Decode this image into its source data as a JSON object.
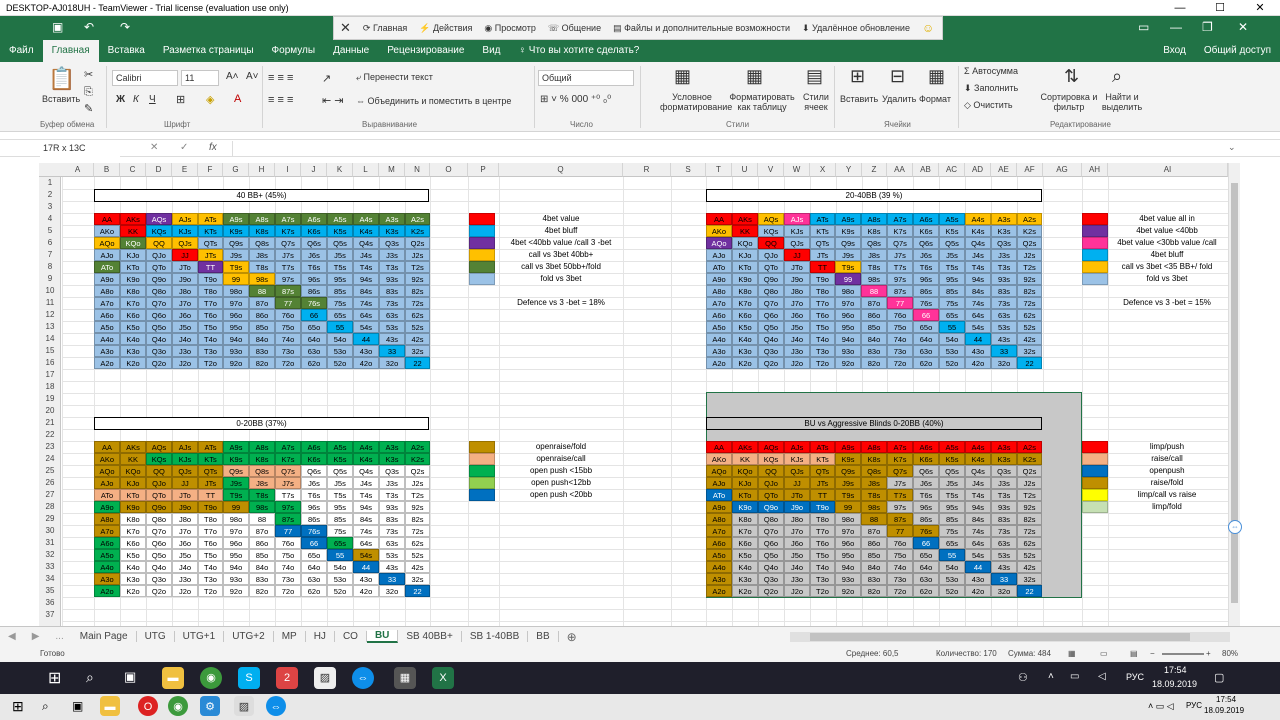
{
  "window": {
    "tv_title": "DESKTOP-AJ018UH - TeamViewer - Trial license (evaluation use only)",
    "min": "—",
    "max": "☐",
    "close": "✕"
  },
  "teamviewer": {
    "items": [
      "Главная",
      "Действия",
      "Просмотр",
      "Общение",
      "Файлы и дополнительные возможности",
      "Удалённое обновление"
    ],
    "icons": [
      "close-icon",
      "home-icon",
      "lightning-icon",
      "eye-icon",
      "chat-icon",
      "file-icon",
      "download-icon",
      "smile-icon"
    ]
  },
  "ribbon_tabs": [
    "Файл",
    "Главная",
    "Вставка",
    "Разметка страницы",
    "Формулы",
    "Данные",
    "Рецензирование",
    "Вид",
    "♀ Что вы хотите сделать?"
  ],
  "ribbon_right": {
    "login": "Вход",
    "share": "Общий доступ"
  },
  "ribbon": {
    "paste": "Вставить",
    "clipboard": "Буфер обмена",
    "font_name": "Calibri",
    "font_size": "11",
    "font_group": "Шрифт",
    "wrap": "Перенести текст",
    "merge": "Объединить и поместить в центре",
    "align_group": "Выравнивание",
    "num_format": "Общий",
    "num_group": "Число",
    "cond": "Условное форматирование",
    "table": "Форматировать как таблицу",
    "styles": "Стили ячеек",
    "styles_group": "Стили",
    "insert": "Вставить",
    "delete": "Удалить",
    "format": "Формат",
    "cells_group": "Ячейки",
    "autosum": "Автосумма",
    "fill": "Заполнить",
    "clear": "Очистить",
    "sort": "Сортировка и фильтр",
    "find": "Найти и выделить",
    "edit_group": "Редактирование",
    "bold": "Ж",
    "italic": "К",
    "underline": "Ч"
  },
  "formula": {
    "namebox": "17R x 13C",
    "fx": "fx",
    "value": ""
  },
  "columns": [
    "A",
    "B",
    "C",
    "D",
    "E",
    "F",
    "G",
    "H",
    "I",
    "J",
    "K",
    "L",
    "M",
    "N",
    "O",
    "P",
    "Q",
    "R",
    "S",
    "T",
    "U",
    "V",
    "W",
    "X",
    "Y",
    "Z",
    "AA",
    "AB",
    "AC",
    "AD",
    "AE",
    "AF",
    "AG",
    "AH",
    "AI"
  ],
  "rows": [
    "1",
    "2",
    "3",
    "4",
    "5",
    "6",
    "7",
    "8",
    "9",
    "10",
    "11",
    "12",
    "13",
    "14",
    "15",
    "16",
    "17",
    "18",
    "19",
    "20",
    "21",
    "22",
    "23",
    "24",
    "25",
    "26",
    "27",
    "28",
    "29",
    "30",
    "31",
    "32",
    "33",
    "34",
    "35",
    "36",
    "37"
  ],
  "titles": {
    "t1": "40 BB+ (45%)",
    "t2": "20-40BB (39 %)",
    "t3": "0-20BB (37%)",
    "t4": "BU vs Aggressive Blinds 0-20BB (40%)"
  },
  "grid": [
    [
      "AA",
      "AKs",
      "AQs",
      "AJs",
      "ATs",
      "A9s",
      "A8s",
      "A7s",
      "A6s",
      "A5s",
      "A4s",
      "A3s",
      "A2s"
    ],
    [
      "AKo",
      "KK",
      "KQs",
      "KJs",
      "KTs",
      "K9s",
      "K8s",
      "K7s",
      "K6s",
      "K5s",
      "K4s",
      "K3s",
      "K2s"
    ],
    [
      "AQo",
      "KQo",
      "QQ",
      "QJs",
      "QTs",
      "Q9s",
      "Q8s",
      "Q7s",
      "Q6s",
      "Q5s",
      "Q4s",
      "Q3s",
      "Q2s"
    ],
    [
      "AJo",
      "KJo",
      "QJo",
      "JJ",
      "JTs",
      "J9s",
      "J8s",
      "J7s",
      "J6s",
      "J5s",
      "J4s",
      "J3s",
      "J2s"
    ],
    [
      "ATo",
      "KTo",
      "QTo",
      "JTo",
      "TT",
      "T9s",
      "T8s",
      "T7s",
      "T6s",
      "T5s",
      "T4s",
      "T3s",
      "T2s"
    ],
    [
      "A9o",
      "K9o",
      "Q9o",
      "J9o",
      "T9o",
      "99",
      "98s",
      "97s",
      "96s",
      "95s",
      "94s",
      "93s",
      "92s"
    ],
    [
      "A8o",
      "K8o",
      "Q8o",
      "J8o",
      "T8o",
      "98o",
      "88",
      "87s",
      "86s",
      "85s",
      "84s",
      "83s",
      "82s"
    ],
    [
      "A7o",
      "K7o",
      "Q7o",
      "J7o",
      "T7o",
      "97o",
      "87o",
      "77",
      "76s",
      "75s",
      "74s",
      "73s",
      "72s"
    ],
    [
      "A6o",
      "K6o",
      "Q6o",
      "J6o",
      "T6o",
      "96o",
      "86o",
      "76o",
      "66",
      "65s",
      "64s",
      "63s",
      "62s"
    ],
    [
      "A5o",
      "K5o",
      "Q5o",
      "J5o",
      "T5o",
      "95o",
      "85o",
      "75o",
      "65o",
      "55",
      "54s",
      "53s",
      "52s"
    ],
    [
      "A4o",
      "K4o",
      "Q4o",
      "J4o",
      "T4o",
      "94o",
      "84o",
      "74o",
      "64o",
      "54o",
      "44",
      "43s",
      "42s"
    ],
    [
      "A3o",
      "K3o",
      "Q3o",
      "J3o",
      "T3o",
      "93o",
      "83o",
      "73o",
      "63o",
      "53o",
      "43o",
      "33",
      "32s"
    ],
    [
      "A2o",
      "K2o",
      "Q2o",
      "J2o",
      "T2o",
      "92o",
      "82o",
      "72o",
      "62o",
      "52o",
      "42o",
      "32o",
      "22"
    ]
  ],
  "legend1": {
    "items": [
      "4bet value",
      "4bet bluff",
      "4bet <40bb value /call 3 -bet",
      "call vs 3bet 40bb+",
      "call vs 3bet 50bb+/fold",
      "fold vs 3bet"
    ],
    "colors": [
      "#ff0000",
      "#00b0f0",
      "#7030a0",
      "#ffc000",
      "#548235",
      "#9bc2e6"
    ],
    "note": "Defence vs 3 -bet = 18%"
  },
  "legend2": {
    "items": [
      "4bet value all in",
      "4bet value <40bb",
      "4bet value <30bb value /call",
      "4bet bluff",
      "call vs 3bet <35 BB+/ fold",
      "fold vs 3bet"
    ],
    "colors": [
      "#ff0000",
      "#7030a0",
      "#ff3399",
      "#00b0f0",
      "#ffc000",
      "#9bc2e6"
    ],
    "note": "Defence vs 3 -bet = 15%"
  },
  "legend3": {
    "items": [
      "openraise/fold",
      "openraise/call",
      "open push <15bb",
      "open push<12bb",
      "open push <20bb"
    ],
    "colors": [
      "#bf8f00",
      "#f4b084",
      "#00b050",
      "#92d050",
      "#0070c0"
    ]
  },
  "legend4": {
    "items": [
      "limp/push",
      "raise/call",
      "openpush",
      "raise/fold",
      "limp/call vs raise",
      "limp/fold"
    ],
    "colors": [
      "#ff0000",
      "#f4b084",
      "#0070c0",
      "#bf8f00",
      "#ffff00",
      "#c6e0b4"
    ]
  },
  "sheet_tabs": [
    "Main Page",
    "UTG",
    "UTG+1",
    "UTG+2",
    "MP",
    "HJ",
    "CO",
    "BU",
    "SB 40BB+",
    "SB 1-40BB",
    "BB"
  ],
  "status": {
    "ready": "Готово",
    "avg": "Среднее: 60,5",
    "count": "Количество: 170",
    "sum": "Сумма: 484",
    "zoom": "80%"
  },
  "tray": {
    "lang": "РУС",
    "time": "17:54",
    "date": "18.09.2019"
  },
  "tray2": {
    "lang": "РУС",
    "time": "17:54",
    "date": "18.09.2019"
  }
}
